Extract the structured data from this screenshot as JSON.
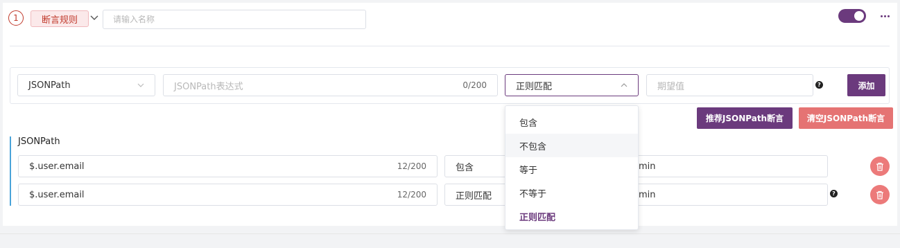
{
  "header": {
    "step_number": "1",
    "tag_label": "断言规则",
    "name_placeholder": "请输入名称",
    "enabled": true
  },
  "rule_form": {
    "type_value": "JSONPath",
    "expression_placeholder": "JSONPath表达式",
    "expression_counter": "0/200",
    "match_value": "正则匹配",
    "expected_placeholder": "期望值",
    "add_label": "添加"
  },
  "actions": {
    "recommend_label": "推荐JSONPath断言",
    "clear_label": "清空JSONPath断言"
  },
  "section": {
    "title": "JSONPath",
    "rows": [
      {
        "path": "$.user.email",
        "counter": "12/200",
        "match": "包含",
        "expected": "min",
        "has_help": false
      },
      {
        "path": "$.user.email",
        "counter": "12/200",
        "match": "正则匹配",
        "expected": "min",
        "has_help": true
      }
    ]
  },
  "dropdown": {
    "options": [
      "包含",
      "不包含",
      "等于",
      "不等于",
      "正则匹配"
    ],
    "hovered": "不包含",
    "selected": "正则匹配"
  },
  "colors": {
    "accent": "#6b3a7d",
    "danger": "#e57373",
    "step_red": "#c0392b",
    "left_bar": "#4aa3d9"
  },
  "icons": {
    "step": "circled-number",
    "collapse": "chevron-down-icon",
    "more": "more-horizontal-icon",
    "help": "question-circle-icon",
    "delete": "trash-icon"
  }
}
